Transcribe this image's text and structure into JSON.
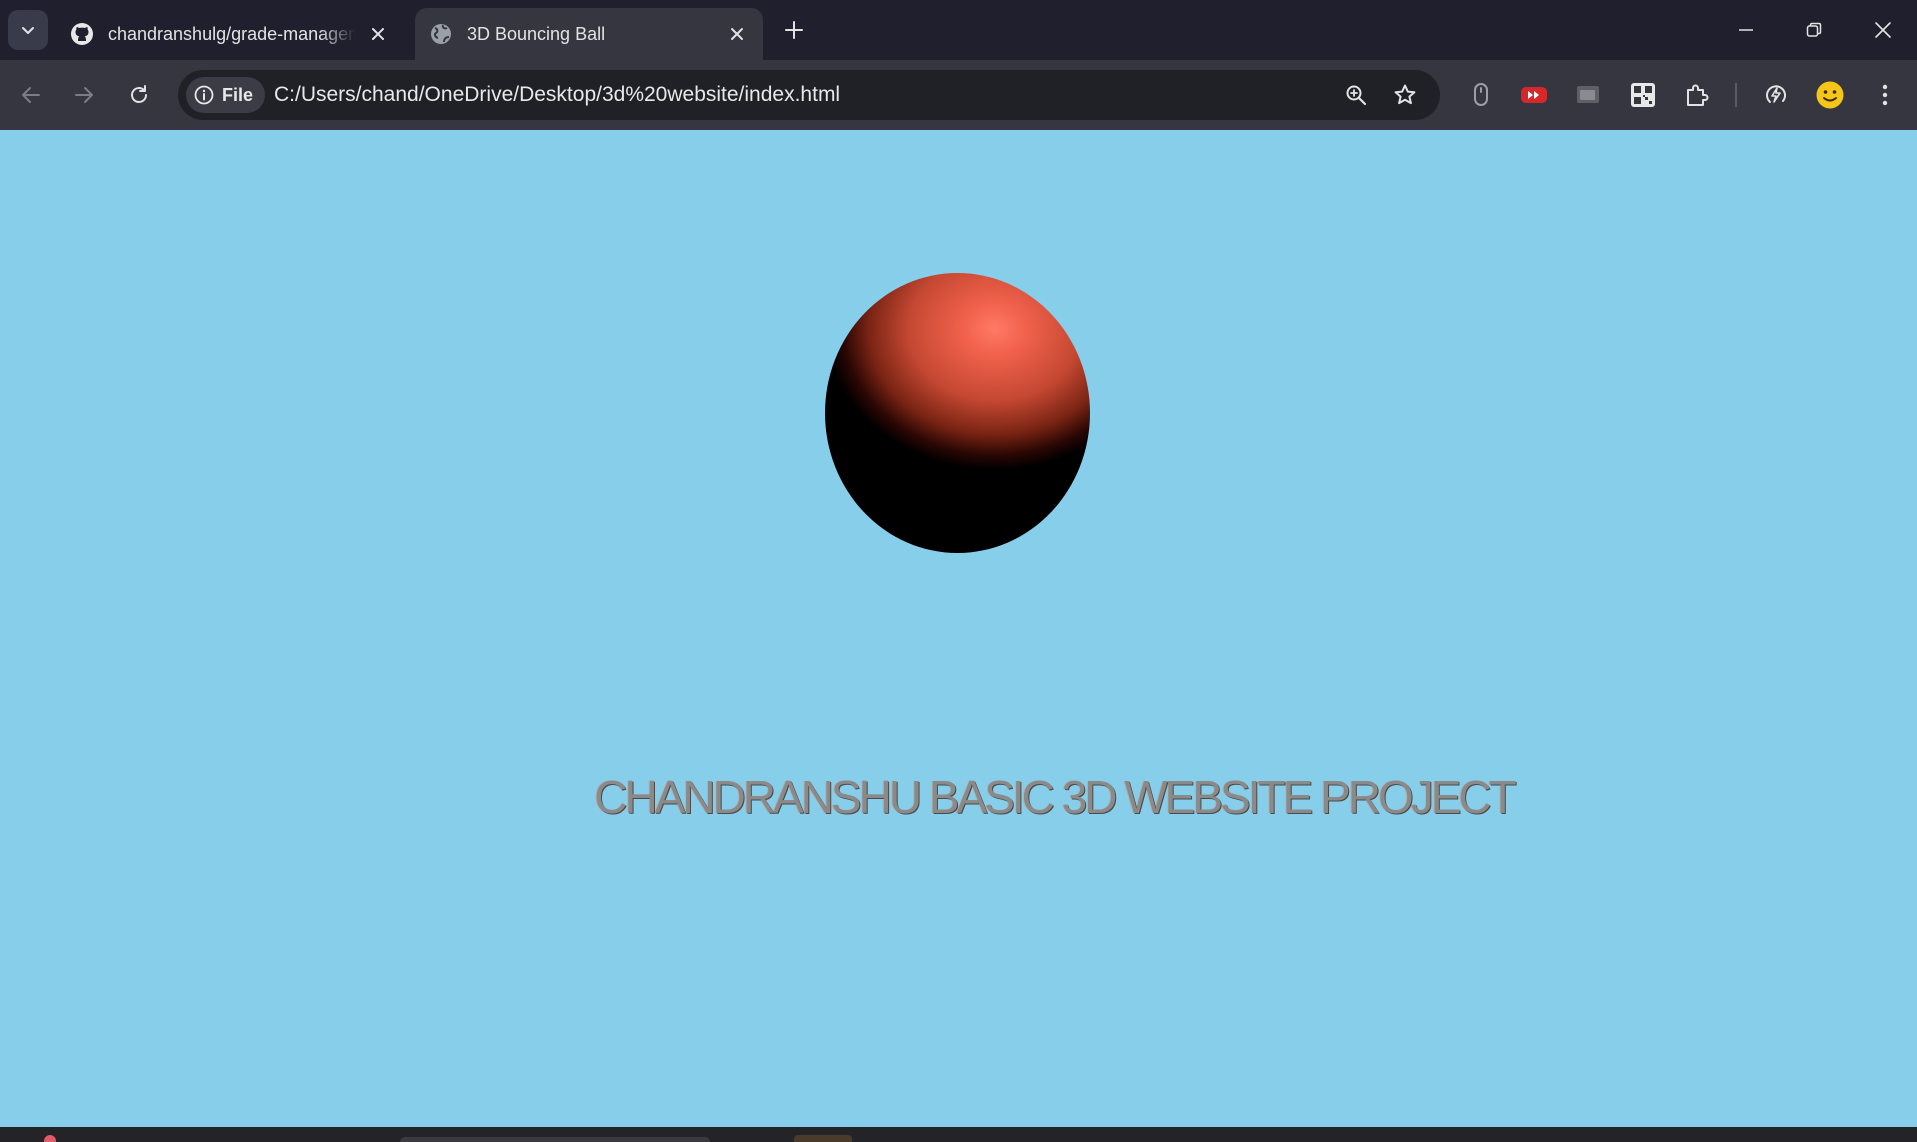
{
  "browser": {
    "tabs": [
      {
        "title": "chandranshulg/grade-management",
        "favicon": "github-icon",
        "active": false
      },
      {
        "title": "3D Bouncing Ball",
        "favicon": "globe-icon",
        "active": true
      }
    ],
    "address_bar": {
      "scheme_chip": "File",
      "url": "C:/Users/chand/OneDrive/Desktop/3d%20website/index.html"
    },
    "extensions": [
      "mouse-icon",
      "youtube-extension-icon",
      "picture-in-picture-icon",
      "qr-code-icon",
      "extensions-puzzle-icon",
      "performance-icon",
      "smiley-profile-icon"
    ]
  },
  "page": {
    "background_color": "#87ceeb",
    "ball_color": "#f2624c",
    "project_text": "CHANDRANSHU BASIC 3D WEBSITE PROJECT"
  }
}
